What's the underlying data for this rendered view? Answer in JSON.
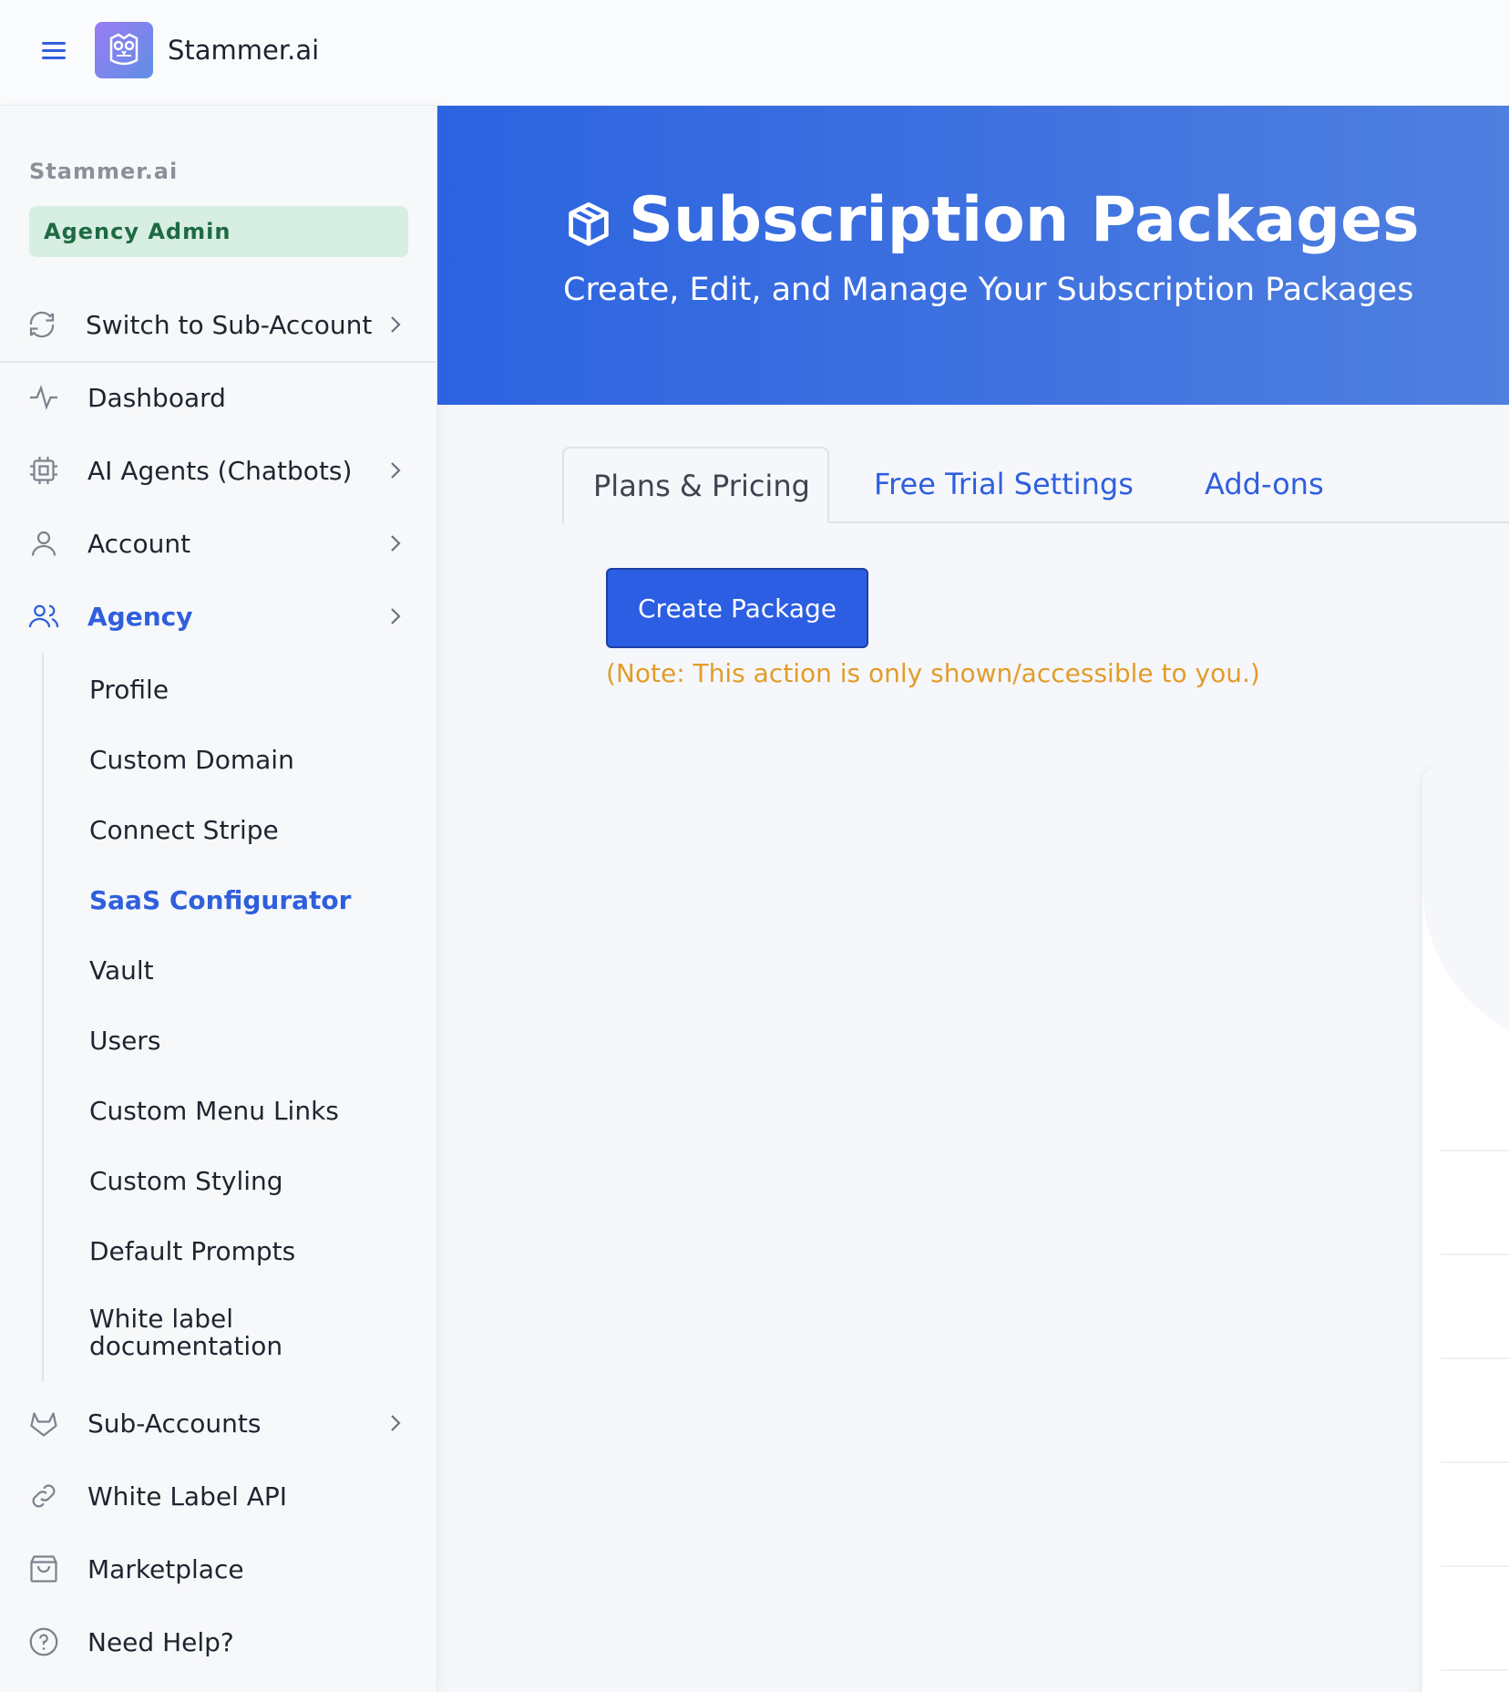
{
  "topbar": {
    "brand": "Stammer.ai"
  },
  "sidebar": {
    "org_name": "Stammer.ai",
    "role_badge": "Agency Admin",
    "switch_label": "Switch to Sub-Account",
    "items": [
      {
        "label": "Dashboard",
        "icon": "activity-icon"
      },
      {
        "label": "AI Agents (Chatbots)",
        "icon": "cpu-icon"
      },
      {
        "label": "Account",
        "icon": "user-icon"
      },
      {
        "label": "Agency",
        "icon": "users-icon"
      },
      {
        "label": "Sub-Accounts",
        "icon": "gitlab-icon"
      },
      {
        "label": "White Label API",
        "icon": "link-icon"
      },
      {
        "label": "Marketplace",
        "icon": "shopping-bag-icon"
      },
      {
        "label": "Need Help?",
        "icon": "help-circle-icon"
      }
    ],
    "agency_subitems": [
      "Profile",
      "Custom Domain",
      "Connect Stripe",
      "SaaS Configurator",
      "Vault",
      "Users",
      "Custom Menu Links",
      "Custom Styling",
      "Default Prompts",
      "White label documentation"
    ],
    "active_subitem": "SaaS Configurator"
  },
  "hero": {
    "title": "Subscription Packages",
    "subtitle": "Create, Edit, and Manage Your Subscription Packages"
  },
  "tabs": [
    "Plans & Pricing",
    "Free Trial Settings",
    "Add-ons"
  ],
  "actions": {
    "create_label": "Create Package",
    "note": "(Note: This action is only shown/accessible to you.)"
  },
  "colors": {
    "accent": "#2f5fdc",
    "badge_bg": "#d7eee3",
    "badge_text": "#1e6b43",
    "note": "#e39c2a"
  }
}
